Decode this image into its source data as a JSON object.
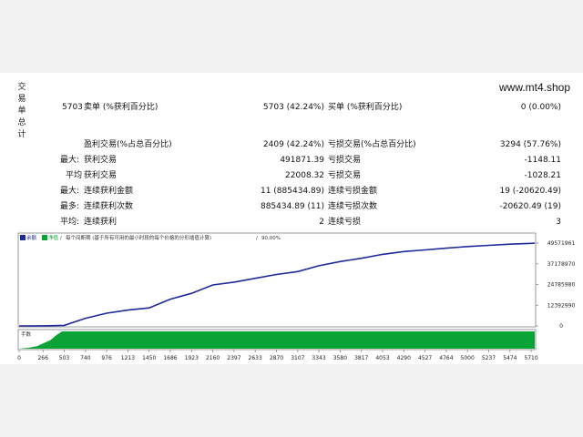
{
  "watermark": "www.mt4.shop",
  "side_label": [
    "交",
    "易",
    "单",
    "总",
    "计"
  ],
  "stats": {
    "row1": {
      "count": "5703",
      "sell_label": "卖单 (%获利百分比)",
      "sell_value": "5703 (42.24%)",
      "buy_label": "买单 (%获利百分比)",
      "buy_value": "0 (0.00%)"
    },
    "row2": {
      "win_label": "盈利交易(%占总百分比)",
      "win_value": "2409 (42.24%)",
      "loss_label": "亏损交易(%占总百分比)",
      "loss_value": "3294 (57.76%)"
    },
    "row3": {
      "prefix": "最大:",
      "win_label": "获利交易",
      "win_value": "491871.39",
      "loss_label": "亏损交易",
      "loss_value": "-1148.11"
    },
    "row4": {
      "prefix": "平均",
      "win_label": "获利交易",
      "win_value": "22008.32",
      "loss_label": "亏损交易",
      "loss_value": "-1028.21"
    },
    "row5": {
      "prefix": "最大:",
      "win_label": "连续获利金额",
      "win_value": "11 (885434.89)",
      "loss_label": "连续亏损金额",
      "loss_value": "19 (-20620.49)"
    },
    "row6": {
      "prefix": "最多:",
      "win_label": "连续获利次数",
      "win_value": "885434.89 (11)",
      "loss_label": "连续亏损次数",
      "loss_value": "-20620.49 (19)"
    },
    "row7": {
      "prefix": "平均:",
      "win_label": "连续获利",
      "win_value": "2",
      "loss_label": "连续亏损",
      "loss_value": "3"
    }
  },
  "chart_legend": {
    "balance": "余额",
    "equity": "净值",
    "note": "每个间断期 (基于所有可用的最小时段的每个价格的分形插值计算)",
    "quality": "90.00%"
  },
  "colors": {
    "balance_line": "#1c2a9a",
    "lot_fill": "#0aa336",
    "axis": "#888888"
  },
  "chart_data": [
    {
      "type": "line",
      "series": [
        {
          "name": "余额",
          "x": [
            0,
            266,
            503,
            740,
            976,
            1213,
            1450,
            1686,
            1923,
            2160,
            2397,
            2633,
            2870,
            3107,
            3343,
            3580,
            3817,
            4053,
            4290,
            4527,
            4764,
            5000,
            5237,
            5474,
            5710,
            5750
          ],
          "values": [
            0,
            50000,
            300000,
            4600000,
            7600000,
            9500000,
            10800000,
            16000000,
            19500000,
            24500000,
            26200000,
            28500000,
            30800000,
            32500000,
            36000000,
            38500000,
            40500000,
            42800000,
            44500000,
            45500000,
            46500000,
            47500000,
            48200000,
            48900000,
            49400000,
            49571961
          ]
        }
      ],
      "yticks": [
        "49571961",
        "37178970",
        "24785980",
        "12392990",
        "0"
      ],
      "ylim": [
        0,
        49571961
      ],
      "xlim": [
        0,
        5750
      ]
    },
    {
      "type": "area",
      "title": "手数",
      "series": [
        {
          "name": "手数",
          "x": [
            0,
            100,
            200,
            266,
            350,
            420,
            480,
            503,
            5750
          ],
          "values": [
            0,
            0.05,
            0.15,
            0.3,
            0.5,
            0.8,
            1,
            1,
            1
          ]
        }
      ],
      "xticks": [
        "0",
        "266",
        "503",
        "740",
        "976",
        "1213",
        "1450",
        "1686",
        "1923",
        "2160",
        "2397",
        "2633",
        "2870",
        "3107",
        "3343",
        "3580",
        "3817",
        "4053",
        "4290",
        "4527",
        "4764",
        "5000",
        "5237",
        "5474",
        "5710"
      ],
      "xlim": [
        0,
        5750
      ]
    }
  ]
}
